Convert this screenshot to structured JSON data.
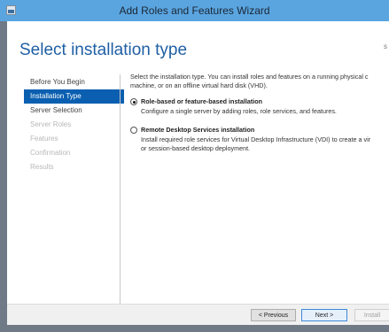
{
  "window": {
    "title": "Add Roles and Features Wizard",
    "titlebar_color": "#5aa5e0",
    "icon": "server-manager-icon"
  },
  "page": {
    "title": "Select installation type",
    "corner_mark": "s"
  },
  "nav": {
    "items": [
      {
        "label": "Before You Begin",
        "state": "normal"
      },
      {
        "label": "Installation Type",
        "state": "active"
      },
      {
        "label": "Server Selection",
        "state": "normal"
      },
      {
        "label": "Server Roles",
        "state": "disabled"
      },
      {
        "label": "Features",
        "state": "disabled"
      },
      {
        "label": "Confirmation",
        "state": "disabled"
      },
      {
        "label": "Results",
        "state": "disabled"
      }
    ]
  },
  "content": {
    "description_line1": "Select the installation type. You can install roles and features on a running physical c",
    "description_line2": "machine, or on an offline virtual hard disk (VHD).",
    "options": [
      {
        "label": "Role-based or feature-based installation",
        "description_lines": [
          "Configure a single server by adding roles, role services, and features."
        ],
        "selected": true
      },
      {
        "label": "Remote Desktop Services installation",
        "description_lines": [
          "Install required role services for Virtual Desktop Infrastructure (VDI) to create a vir",
          "or session-based desktop deployment."
        ],
        "selected": false
      }
    ]
  },
  "footer": {
    "previous_label": "< Previous",
    "next_label": "Next >",
    "install_label": "Install"
  }
}
